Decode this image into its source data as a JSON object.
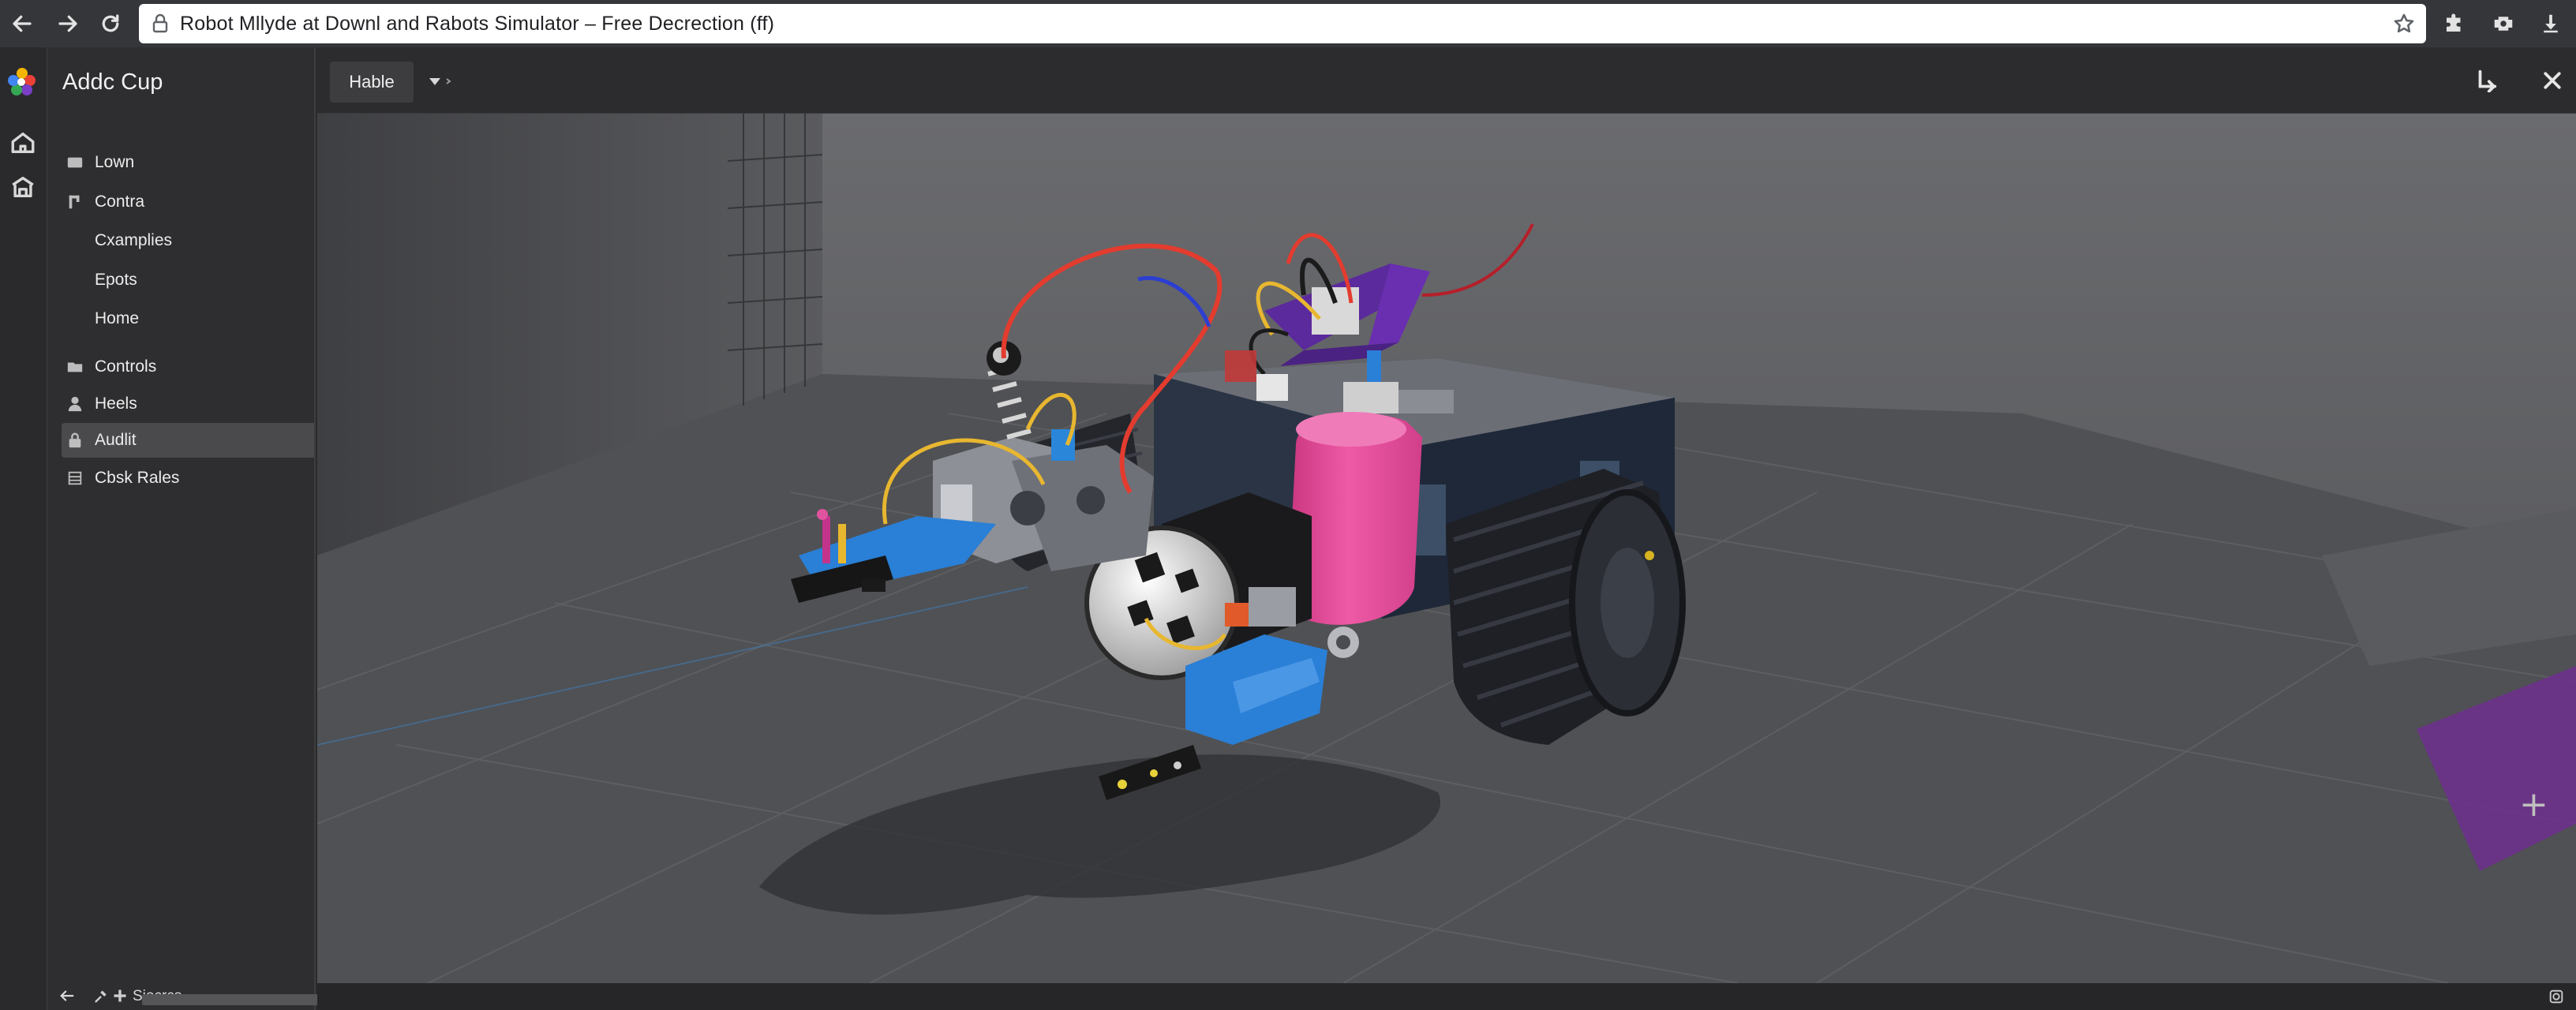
{
  "browser": {
    "url_text": "Robot Mllyde at Downl and Rabots Simulator  –  Free Decrection (ff)"
  },
  "app": {
    "title": "Addc Cup"
  },
  "sidebar": {
    "items": [
      {
        "label": "Lown",
        "icon": "folder-icon"
      },
      {
        "label": "Contra",
        "icon": "branch-icon"
      },
      {
        "label": "Cxamplies",
        "icon": ""
      },
      {
        "label": "Epots",
        "icon": ""
      },
      {
        "label": "Home",
        "icon": ""
      },
      {
        "label": "Controls",
        "icon": "folder-icon"
      },
      {
        "label": "Heels",
        "icon": "person-icon"
      },
      {
        "label": "Audlit",
        "icon": "lock-icon"
      },
      {
        "label": "Cbsk Rales",
        "icon": "list-icon"
      }
    ],
    "active_index": 7,
    "footer_label": "Siocrcs"
  },
  "viewport": {
    "mode_label": "Hable"
  },
  "colors": {
    "accent_pink": "#e2509c",
    "accent_purple": "#6a2fb0",
    "accent_blue": "#2a7fd6",
    "tread": "#23252b"
  }
}
